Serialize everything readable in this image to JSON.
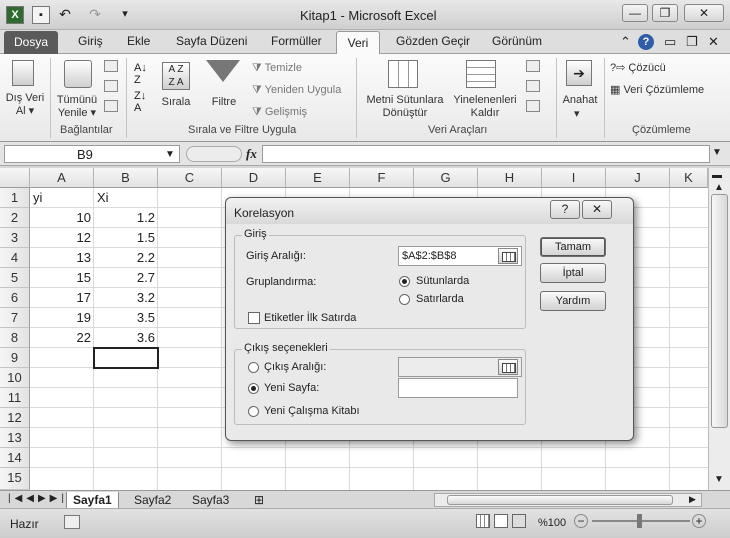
{
  "window": {
    "title": "Kitap1  -  Microsoft Excel",
    "undo_glyph": "↶",
    "redo_glyph": "↷",
    "minimize": "—",
    "restore": "❐",
    "close": "✕"
  },
  "ribbon_tabs": {
    "file": "Dosya",
    "tabs": [
      "Giriş",
      "Ekle",
      "Sayfa Düzeni",
      "Formüller",
      "Veri",
      "Gözden Geçir",
      "Görünüm"
    ],
    "active": "Veri",
    "help_glyph": "?"
  },
  "ribbon": {
    "external_data": "Dış Veri\nAl ▾",
    "refresh_all": "Tümünü\nYenile ▾",
    "connections_group": "Bağlantılar",
    "sort": "Sırala",
    "filter": "Filtre",
    "clear": "Temizle",
    "reapply": "Yeniden Uygula",
    "advanced": "Gelişmiş",
    "sort_filter_group": "Sırala ve Filtre Uygula",
    "text_to_columns": "Metni Sütunlara\nDönüştür",
    "remove_duplicates": "Yinelenenleri\nKaldır",
    "data_tools_group": "Veri Araçları",
    "outline": "Anahat",
    "solver": "Çözücü",
    "data_analysis": "Veri Çözümleme",
    "analysis_group": "Çözümleme"
  },
  "formula_bar": {
    "name_box": "B9",
    "fx": "fx",
    "formula": ""
  },
  "grid": {
    "columns": [
      "A",
      "B",
      "C",
      "D",
      "E",
      "F",
      "G",
      "H",
      "I",
      "J",
      "K"
    ],
    "rows": [
      "1",
      "2",
      "3",
      "4",
      "5",
      "6",
      "7",
      "8",
      "9",
      "10",
      "11",
      "12",
      "13",
      "14",
      "15"
    ],
    "header": [
      "yi",
      "Xi"
    ],
    "data": [
      [
        "10",
        "1.2"
      ],
      [
        "12",
        "1.5"
      ],
      [
        "13",
        "2.2"
      ],
      [
        "15",
        "2.7"
      ],
      [
        "17",
        "3.2"
      ],
      [
        "19",
        "3.5"
      ],
      [
        "22",
        "3.6"
      ]
    ]
  },
  "sheet_tabs": {
    "tabs": [
      "Sayfa1",
      "Sayfa2",
      "Sayfa3"
    ],
    "active": "Sayfa1"
  },
  "status_bar": {
    "mode": "Hazır",
    "zoom": "%100"
  },
  "dialog": {
    "title": "Korelasyon",
    "help": "?",
    "close": "✕",
    "input_section": "Giriş",
    "input_range_label": "Giriş Aralığı:",
    "input_range_value": "$A$2:$B$8",
    "grouping_label": "Gruplandırma:",
    "group_columns": "Sütunlarda",
    "group_rows": "Satırlarda",
    "grouping_selected": "Sütunlarda",
    "labels_first_row": "Etiketler İlk Satırda",
    "labels_first_row_checked": false,
    "output_section": "Çıkış seçenekleri",
    "output_range_label": "Çıkış Aralığı:",
    "output_range_value": "",
    "new_sheet_label": "Yeni Sayfa:",
    "new_sheet_value": "",
    "new_workbook_label": "Yeni Çalışma Kitabı",
    "output_selected": "Yeni Sayfa:",
    "ok": "Tamam",
    "cancel": "İptal",
    "help_button": "Yardım"
  }
}
